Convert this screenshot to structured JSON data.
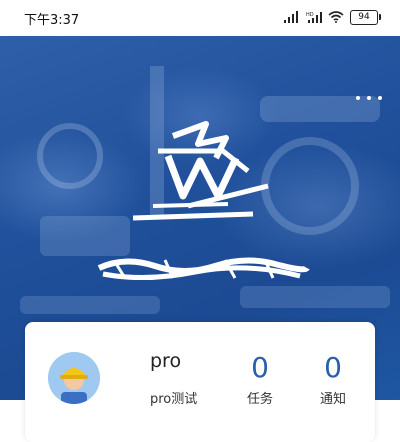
{
  "status_bar": {
    "time": "下午3:37",
    "battery": "94",
    "icons": [
      "signal-icon",
      "signal-hd-icon",
      "wifi-icon",
      "battery-icon"
    ]
  },
  "header": {
    "menu_icon": "more-dots-icon",
    "logo_icon": "company-logo-icon"
  },
  "profile": {
    "name": "pro",
    "role": "pro测试",
    "avatar_icon": "worker-helmet-avatar-icon"
  },
  "stats": [
    {
      "count": "0",
      "label": "任务"
    },
    {
      "count": "0",
      "label": "通知"
    }
  ],
  "colors": {
    "hero_blue": "#21519c",
    "accent_blue": "#2a5fb0",
    "avatar_bg": "#9fc9f0",
    "helmet_yellow": "#f5c518"
  }
}
